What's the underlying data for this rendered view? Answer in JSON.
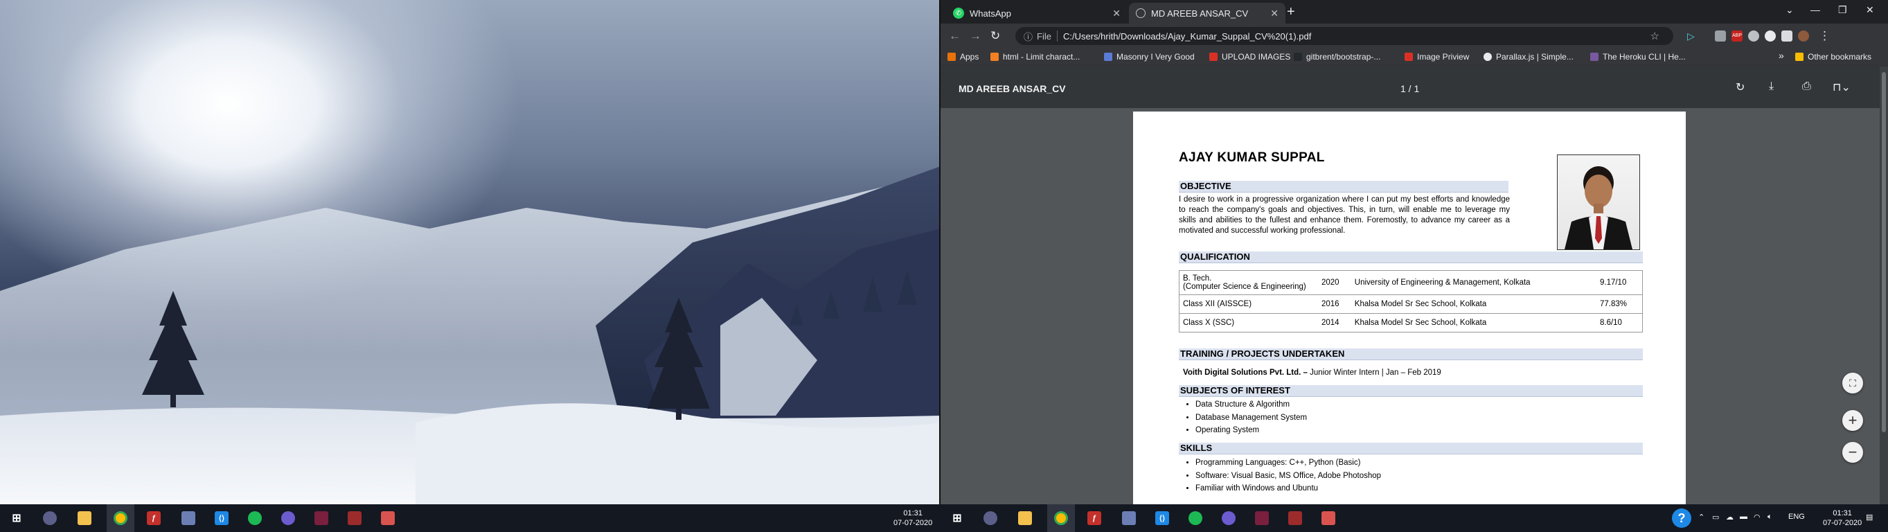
{
  "browser": {
    "tabs": [
      {
        "title": "WhatsApp",
        "icon": "whatsapp-icon",
        "active": false
      },
      {
        "title": "MD AREEB ANSAR_CV",
        "icon": "pdf-globe-icon",
        "active": true
      }
    ],
    "address": {
      "scheme": "File",
      "url": "C:/Users/hrith/Downloads/Ajay_Kumar_Suppal_CV%20(1).pdf"
    },
    "bookmarks": [
      {
        "label": "Apps",
        "color": "#e8710a"
      },
      {
        "label": "html - Limit charact...",
        "color": "#f48024"
      },
      {
        "label": "Masonry I Very Good",
        "color": "#5b7bd5"
      },
      {
        "label": "UPLOAD IMAGES",
        "color": "#d93025"
      },
      {
        "label": "gitbrent/bootstrap-...",
        "color": "#24292e"
      },
      {
        "label": "Image Priview",
        "color": "#d93025"
      },
      {
        "label": "Parallax.js | Simple...",
        "color": "#e8eaed"
      },
      {
        "label": "The Heroku CLI | He...",
        "color": "#79589f"
      }
    ],
    "bookmarks_overflow": "»",
    "other_bookmarks": "Other bookmarks"
  },
  "pdf_viewer": {
    "title": "MD AREEB ANSAR_CV",
    "page_indicator": "1 / 1"
  },
  "cv": {
    "name": "AJAY KUMAR SUPPAL",
    "objective_heading": "OBJECTIVE",
    "objective_text": "I desire to work in a progressive organization where I can put my best efforts and knowledge to reach the company's goals and objectives. This, in turn, will enable me to leverage my skills and abilities  to the fullest and enhance them. Foremostly, to advance my career as a motivated and  successful working professional.",
    "qualification_heading": "QUALIFICATION",
    "qualifications": [
      {
        "degree": "B. Tech.",
        "degree_sub": "(Computer Science & Engineering)",
        "year": "2020",
        "institute": "University of Engineering & Management, Kolkata",
        "score": "9.17/10"
      },
      {
        "degree": "Class XII (AISSCE)",
        "degree_sub": "",
        "year": "2016",
        "institute": "Khalsa Model Sr Sec School, Kolkata",
        "score": "77.83%"
      },
      {
        "degree": "Class X (SSC)",
        "degree_sub": "",
        "year": "2014",
        "institute": "Khalsa Model Sr Sec School, Kolkata",
        "score": "8.6/10"
      }
    ],
    "training_heading": "TRAINING / PROJECTS UNDERTAKEN",
    "training_company": "Voith Digital Solutions Pvt. Ltd. –",
    "training_detail": " Junior Winter Intern | Jan – Feb 2019",
    "interest_heading": "SUBJECTS OF INTEREST",
    "interests": [
      "Data Structure & Algorithm",
      "Database Management System",
      "Operating System"
    ],
    "skills_heading": "SKILLS",
    "skills": [
      "Programming Languages: C++, Python (Basic)",
      "Software: Visual Basic, MS Office, Adobe Photoshop",
      "Familiar with Windows and Ubuntu"
    ]
  },
  "taskbar_left": {
    "time": "01:31",
    "date": "07-07-2020"
  },
  "taskbar_right": {
    "time": "01:31",
    "date": "07-07-2020",
    "language": "ENG"
  }
}
